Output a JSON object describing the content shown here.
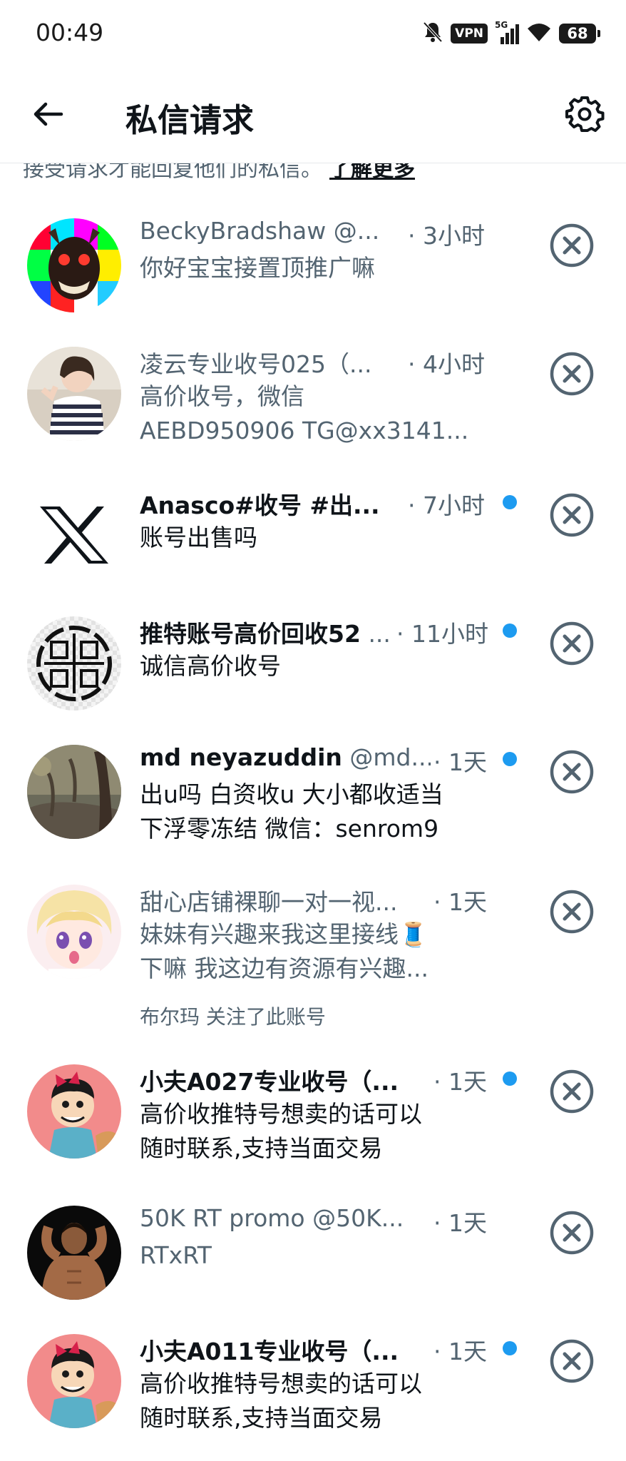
{
  "status_bar": {
    "time": "00:49",
    "vpn": "VPN",
    "network": "5G",
    "battery": "68"
  },
  "header": {
    "title": "私信请求"
  },
  "info": {
    "text": "接受请求才能回复他们的私信。",
    "learn_more": "了解更多"
  },
  "requests": [
    {
      "name": "BeckyBradshaw",
      "handle": "@...",
      "time": "· 3小时",
      "lines": [
        "你好宝宝接置顶推广嘛"
      ],
      "unread": false
    },
    {
      "name": "凌云专业收号025（...",
      "handle": "",
      "time": "· 4小时",
      "lines": [
        "高价收号，微信",
        "AEBD950906 TG@xx3141..."
      ],
      "unread": false
    },
    {
      "name": "Anasco#收号 #出...",
      "handle": "",
      "time": "· 7小时",
      "lines": [
        "账号出售吗"
      ],
      "unread": true
    },
    {
      "name": "推特账号高价回收52",
      "handle": "...",
      "time": "· 11小时",
      "lines": [
        "诚信高价收号"
      ],
      "unread": true
    },
    {
      "name": "md neyazuddin",
      "handle": "@md...",
      "time": "· 1天",
      "lines": [
        "出u吗 白资收u 大小都收适当",
        "下浮零冻结 微信：senrom9"
      ],
      "unread": true
    },
    {
      "name": "甜心店铺裸聊一对一视...",
      "handle": "",
      "time": "· 1天",
      "lines": [
        "妹妹有兴趣来我这里接线🧵",
        "下嘛 我这边有资源有兴趣..."
      ],
      "unread": false,
      "followed_by": "布尔玛 关注了此账号"
    },
    {
      "name": "小夫A027专业收号（...",
      "handle": "",
      "time": "· 1天",
      "lines": [
        "高价收推特号想卖的话可以",
        "随时联系,支持当面交易"
      ],
      "unread": true
    },
    {
      "name": "50K RT promo",
      "handle": "@50K...",
      "time": "· 1天",
      "lines": [
        "RTxRT"
      ],
      "unread": false
    },
    {
      "name": "小夫A011专业收号（...",
      "handle": "",
      "time": "· 1天",
      "lines": [
        "高价收推特号想卖的话可以",
        "随时联系,支持当面交易"
      ],
      "unread": true
    }
  ],
  "colors": {
    "accent": "#1d9bf0",
    "text": "#0f1419",
    "muted": "#536471"
  },
  "icons": {
    "back": "arrow-left-icon",
    "settings": "gear-icon",
    "dismiss": "close-circle-icon"
  }
}
